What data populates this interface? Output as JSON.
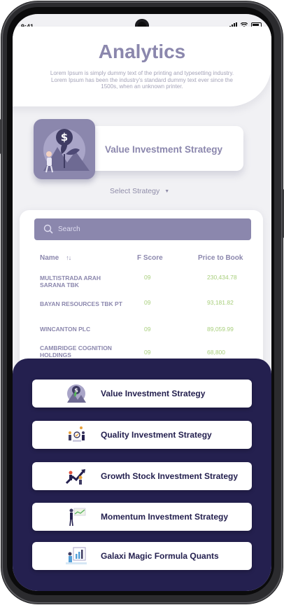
{
  "status_bar": {
    "time": "9:41"
  },
  "header": {
    "title": "Analytics",
    "subtitle": "Lorem Ipsum is simply dummy text of the printing and typesetting industry. Lorem Ipsum has been the industry's standard dummy text ever since the 1500s, when an unknown printer."
  },
  "selected_strategy": {
    "name": "Value Investment Strategy",
    "select_label": "Select Strategy"
  },
  "search": {
    "placeholder": "Search"
  },
  "table": {
    "columns": [
      "Name",
      "F Score",
      "Price to Book"
    ],
    "rows": [
      {
        "name": "MULTISTRADA ARAH SARANA TBK",
        "f_score": "09",
        "price_to_book": "230,434.78"
      },
      {
        "name": "BAYAN RESOURCES TBK PT",
        "f_score": "09",
        "price_to_book": "93,181.82"
      },
      {
        "name": "WINCANTON PLC",
        "f_score": "09",
        "price_to_book": "89,059.99"
      },
      {
        "name": "CAMBRIDGE COGNITION HOLDINGS",
        "f_score": "09",
        "price_to_book": "68,800"
      }
    ]
  },
  "strategy_menu": [
    {
      "label": "Value Investment Strategy",
      "icon": "dollar-plant-icon"
    },
    {
      "label": "Quality Investment Strategy",
      "icon": "quality-check-icon"
    },
    {
      "label": "Growth Stock Investment Strategy",
      "icon": "growth-arrow-icon"
    },
    {
      "label": "Momentum Investment Strategy",
      "icon": "momentum-chart-icon"
    },
    {
      "label": "Galaxi Magic Formula Quants",
      "icon": "formula-board-icon"
    }
  ],
  "colors": {
    "accent": "#8b87ad",
    "sheet": "#24204f",
    "positive": "#a8cf7c"
  }
}
